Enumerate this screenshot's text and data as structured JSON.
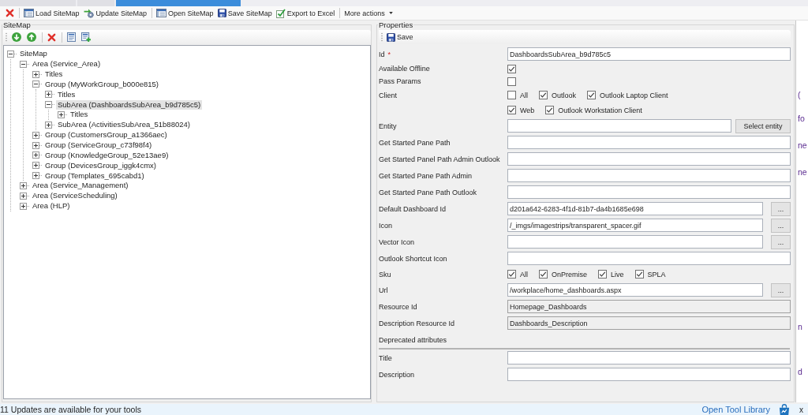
{
  "document_tabs": [
    {
      "selected": false
    },
    {
      "selected": false
    },
    {
      "selected": true
    }
  ],
  "toolbar": {
    "groups": [
      [
        {
          "kind": "icon_button"
        }
      ],
      [
        {
          "kind": "button",
          "label": "Load SiteMap"
        },
        {
          "kind": "button",
          "label": "Update SiteMap"
        }
      ],
      [
        {
          "kind": "button",
          "label": "Open SiteMap"
        },
        {
          "kind": "button",
          "label": "Save SiteMap"
        },
        {
          "kind": "button",
          "label": "Export to Excel"
        }
      ],
      [
        {
          "kind": "menu",
          "label": "More actions"
        }
      ]
    ]
  },
  "sitemap_panel": {
    "title": "SiteMap",
    "toolbar": {
      "groups": [
        [
          {
            "kind": "icon_button"
          },
          {
            "kind": "icon_button"
          }
        ],
        [
          {
            "kind": "icon_button"
          }
        ],
        [
          {
            "kind": "icon_button"
          },
          {
            "kind": "icon_button"
          }
        ]
      ]
    },
    "tree": [
      {
        "label": "SiteMap",
        "expanded": true,
        "selected": false,
        "children": [
          {
            "label": "Area (Service_Area)",
            "expanded": true,
            "selected": false,
            "children": [
              {
                "label": "Titles",
                "expanded": false,
                "selected": false
              },
              {
                "label": "Group (MyWorkGroup_b000e815)",
                "expanded": true,
                "selected": false,
                "children": [
                  {
                    "label": "Titles",
                    "expanded": false,
                    "selected": false
                  },
                  {
                    "label": "SubArea (DashboardsSubArea_b9d785c5)",
                    "expanded": true,
                    "selected": true,
                    "children": [
                      {
                        "label": "Titles",
                        "expanded": false,
                        "selected": false
                      }
                    ]
                  },
                  {
                    "label": "SubArea (ActivitiesSubArea_51b88024)",
                    "expanded": false,
                    "selected": false
                  }
                ]
              },
              {
                "label": "Group (CustomersGroup_a1366aec)",
                "expanded": false,
                "selected": false
              },
              {
                "label": "Group (ServiceGroup_c73f98f4)",
                "expanded": false,
                "selected": false
              },
              {
                "label": "Group (KnowledgeGroup_52e13ae9)",
                "expanded": false,
                "selected": false
              },
              {
                "label": "Group (DevicesGroup_iggk4cmx)",
                "expanded": false,
                "selected": false
              },
              {
                "label": "Group (Templates_695cabd1)",
                "expanded": false,
                "selected": false
              }
            ]
          },
          {
            "label": "Area (Service_Management)",
            "expanded": false,
            "selected": false
          },
          {
            "label": "Area (ServiceScheduling)",
            "expanded": false,
            "selected": false
          },
          {
            "label": "Area (HLP)",
            "expanded": false,
            "selected": false
          }
        ]
      }
    ]
  },
  "properties_panel": {
    "title": "Properties",
    "toolbar": [
      {
        "kind": "button",
        "label": "Save"
      }
    ],
    "fields": [
      {
        "kind": "text",
        "label": "Id",
        "required_mark": "*",
        "value": "DashboardsSubArea_b9d785c5",
        "read_only": false
      },
      {
        "kind": "checkbox",
        "label": "Available Offline",
        "checked": true
      },
      {
        "kind": "checkbox",
        "label": "Pass Params",
        "checked": false
      },
      {
        "kind": "options",
        "label": "Client",
        "option_rows": [
          [
            {
              "label": "All",
              "checked": false
            },
            {
              "label": "Outlook",
              "checked": true
            },
            {
              "label": "Outlook Laptop Client",
              "checked": true
            }
          ],
          [
            {
              "label": "Web",
              "checked": true
            },
            {
              "label": "Outlook Workstation Client",
              "checked": true
            }
          ]
        ]
      },
      {
        "kind": "picker",
        "label": "Entity",
        "button": "Select entity",
        "read_only": false
      },
      {
        "kind": "text",
        "label": "Get Started Pane Path",
        "read_only": false
      },
      {
        "kind": "text",
        "label": "Get Started Panel Path Admin Outlook",
        "read_only": false
      },
      {
        "kind": "text",
        "label": "Get Started Pane Path Admin",
        "read_only": false
      },
      {
        "kind": "text",
        "label": "Get Started Pane Path Outlook",
        "read_only": false
      },
      {
        "kind": "browse",
        "label": "Default Dashboard Id",
        "value": "d201a642-6283-4f1d-81b7-da4b1685e698",
        "button": "...",
        "read_only": false
      },
      {
        "kind": "browse",
        "label": "Icon",
        "value": "/_imgs/imagestrips/transparent_spacer.gif",
        "button": "...",
        "read_only": false
      },
      {
        "kind": "browse",
        "label": "Vector Icon",
        "button": "...",
        "read_only": false
      },
      {
        "kind": "text",
        "label": "Outlook Shortcut Icon",
        "read_only": false
      },
      {
        "kind": "options",
        "label": "Sku",
        "option_rows": [
          [
            {
              "label": "All",
              "checked": true
            },
            {
              "label": "OnPremise",
              "checked": true
            },
            {
              "label": "Live",
              "checked": true
            },
            {
              "label": "SPLA",
              "checked": true
            }
          ]
        ]
      },
      {
        "kind": "browse",
        "label": "Url",
        "value": "/workplace/home_dashboards.aspx",
        "button": "...",
        "read_only": false
      },
      {
        "kind": "text",
        "label": "Resource Id",
        "value": "Homepage_Dashboards",
        "read_only": true
      },
      {
        "kind": "text",
        "label": "Description Resource Id",
        "value": "Dashboards_Description",
        "read_only": true
      },
      {
        "kind": "section",
        "label": "Deprecated attributes"
      },
      {
        "kind": "text",
        "label": "Title",
        "read_only": false
      },
      {
        "kind": "text",
        "label": "Description",
        "read_only": false
      }
    ]
  },
  "background_window": {
    "text_fragments": [
      "(",
      "fo",
      "ne",
      "ne",
      "n",
      "d"
    ]
  },
  "status_bar": {
    "message": "11 Updates are available for your tools",
    "link": "Open Tool Library",
    "close": "x"
  }
}
